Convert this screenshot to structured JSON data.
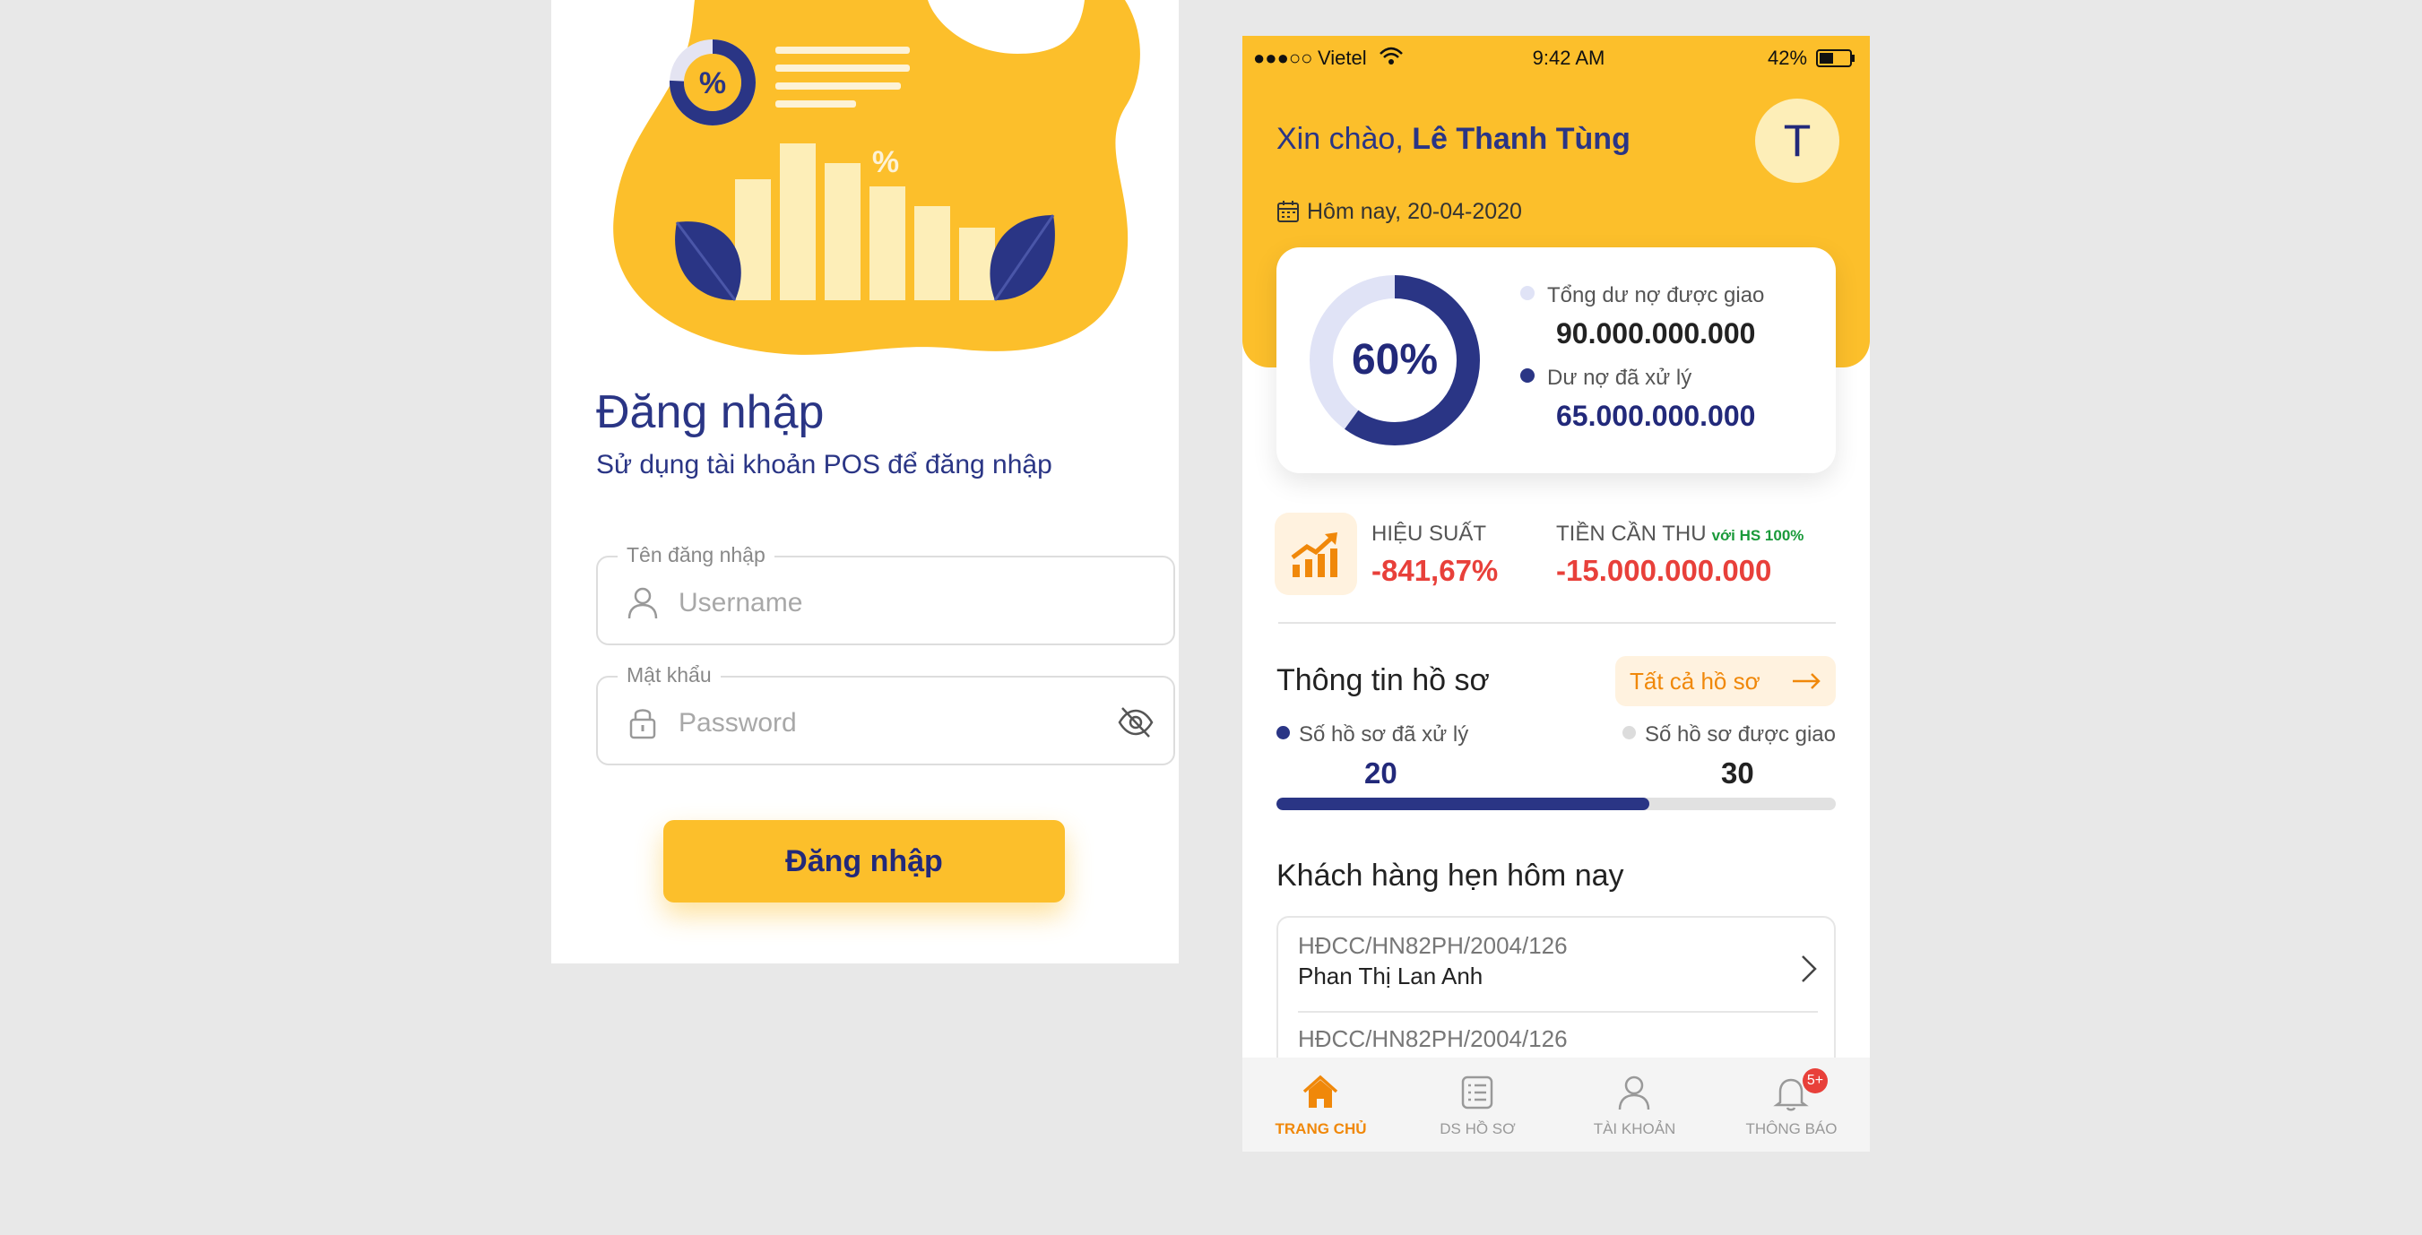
{
  "login": {
    "title": "Đăng nhập",
    "subtitle": "Sử dụng tài khoản POS để đăng nhập",
    "username": {
      "label": "Tên đăng nhập",
      "placeholder": "Username",
      "value": ""
    },
    "password": {
      "label": "Mật khẩu",
      "placeholder": "Password",
      "value": ""
    },
    "submit_label": "Đăng nhập",
    "illustration_icons": [
      "percent-icon",
      "bar-chart-illustration",
      "leaf-icon"
    ]
  },
  "status_bar": {
    "signal": "●●●○○",
    "carrier": "Vietel",
    "time": "9:42 AM",
    "battery": "42%"
  },
  "header": {
    "greeting": "Xin chào, ",
    "user_name": "Lê Thanh Tùng",
    "avatar_initial": "T",
    "date_label": "Hôm nay, 20-04-2020"
  },
  "summary": {
    "percent_label": "60%",
    "percent": 60,
    "assigned_label": "Tổng dư nợ được giao",
    "assigned_value": "90.000.000.000",
    "processed_label": "Dư nợ đã xử lý",
    "processed_value": "65.000.000.000"
  },
  "kpi": {
    "efficiency_label": "HIỆU SUẤT",
    "efficiency_value": "-841,67%",
    "collect_label": "TIỀN CẦN THU",
    "collect_note": "với HS 100%",
    "collect_value": "-15.000.000.000"
  },
  "records": {
    "title": "Thông tin hồ sơ",
    "all_button": "Tất cả hồ sơ",
    "processed_label": "Số hồ sơ đã xử lý",
    "processed_count": "20",
    "assigned_label": "Số hồ sơ được giao",
    "assigned_count": "30",
    "progress_fraction": 0.6667
  },
  "appointments": {
    "title": "Khách hàng hẹn hôm nay",
    "items": [
      {
        "code": "HĐCC/HN82PH/2004/126",
        "customer": "Phan Thị Lan Anh"
      },
      {
        "code": "HĐCC/HN82PH/2004/126",
        "customer": ""
      }
    ]
  },
  "tabs": [
    {
      "label": "TRANG CHỦ",
      "icon": "home-icon",
      "active": true
    },
    {
      "label": "DS HỒ SƠ",
      "icon": "list-icon",
      "active": false
    },
    {
      "label": "TÀI KHOẢN",
      "icon": "user-icon",
      "active": false
    },
    {
      "label": "THÔNG BÁO",
      "icon": "bell-icon",
      "active": false,
      "badge": "5+"
    }
  ],
  "colors": {
    "brand_yellow": "#fcbf2b",
    "navy": "#2a3585",
    "negative": "#e8403a",
    "accent_orange": "#f0880a",
    "positive_green": "#1a9a3a"
  }
}
